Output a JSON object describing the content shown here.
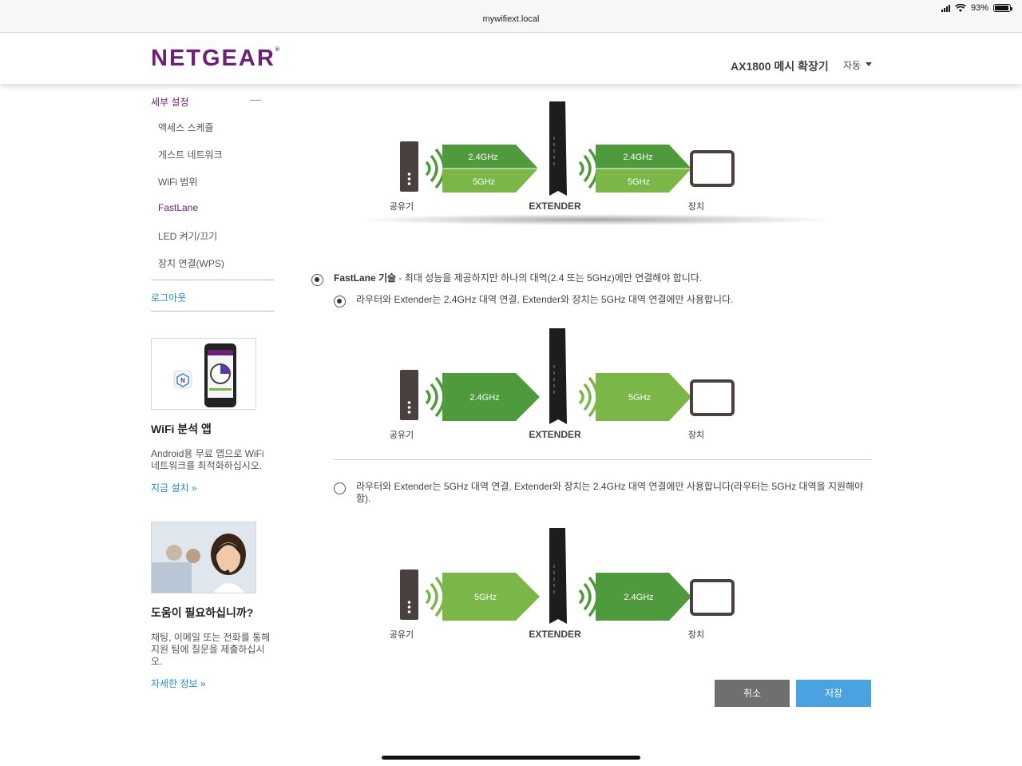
{
  "browser": {
    "url": "mywifiext.local",
    "battery": "93%"
  },
  "header": {
    "logo": "NETGEAR",
    "logo_mark": "®",
    "product": "AX1800 메시 확장기",
    "language": "자동"
  },
  "sidebar": {
    "section_title": "세부 설정",
    "collapse_symbol": "—",
    "items": [
      {
        "label": "액세스 스케쥴"
      },
      {
        "label": "게스트 네트워크"
      },
      {
        "label": "WiFi 범위"
      },
      {
        "label": "FastLane"
      },
      {
        "label": "LED 켜기/끄기"
      },
      {
        "label": "장치 연결(WPS)"
      }
    ],
    "logout": "로그아웃",
    "promo_app": {
      "title": "WiFi 분석 앱",
      "text": "Android용 무료 앱으로 WiFi 네트워크를 최적화하십시오.",
      "link": "지금 설치 »"
    },
    "promo_help": {
      "title": "도움이 필요하십니까?",
      "text": "채팅, 이메일 또는 전화를 통해 지원 팀에 질문을 제출하십시오.",
      "link": "자세한 정보 »"
    }
  },
  "diagram_labels": {
    "router": "공유기",
    "extender": "EXTENDER",
    "device": "장치",
    "band_24": "2.4GHz",
    "band_5": "5GHz"
  },
  "options": {
    "fastlane_title": "FastLane 기술",
    "fastlane_desc": " - 최대 성능을 제공하지만 하나의 대역(2.4 또는 5GHz)에만 연결해야 합니다.",
    "sub1": "라우터와 Extender는 2.4GHz 대역 연결, Extender와 장치는 5GHz 대역 연결에만 사용합니다.",
    "sub2": "라우터와 Extender는 5GHz 대역 연결, Extender와 장치는 2.4GHz 대역 연결에만 사용합니다(라우터는 5GHz 대역을 지원해야 함)."
  },
  "buttons": {
    "cancel": "취소",
    "save": "저장"
  },
  "colors": {
    "brand": "#6d2077",
    "link": "#2a8ad4",
    "green_dark": "#4e9a3c",
    "green_light": "#7ab648",
    "save": "#4aa3e0",
    "cancel": "#6f6f6f"
  }
}
